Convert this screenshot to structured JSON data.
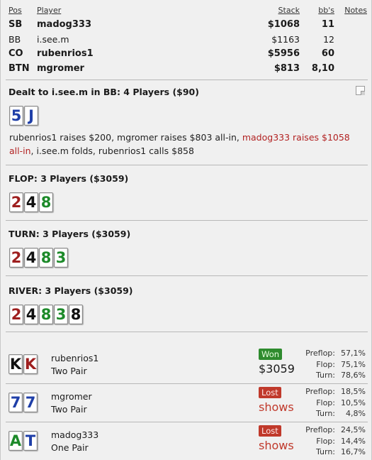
{
  "table": {
    "headers": {
      "pos": "Pos",
      "player": "Player",
      "stack": "Stack",
      "bb": "bb's",
      "notes": "Notes"
    },
    "rows": [
      {
        "pos": "SB",
        "player": "madog333",
        "stack": "$1068",
        "bb": "11",
        "bold": true
      },
      {
        "pos": "BB",
        "player": "i.see.m",
        "stack": "$1163",
        "bb": "12",
        "bold": false
      },
      {
        "pos": "CO",
        "player": "rubenrios1",
        "stack": "$5956",
        "bb": "60",
        "bold": true
      },
      {
        "pos": "BTN",
        "player": "mgromer",
        "stack": "$813",
        "bb": "8,10",
        "bold": true
      }
    ]
  },
  "preflop": {
    "title": "Dealt to i.see.m in BB: 4 Players ($90)",
    "cards": [
      {
        "rank": "5",
        "suit": "blue"
      },
      {
        "rank": "J",
        "suit": "blue"
      }
    ],
    "actions_plain_1": "rubenrios1 raises $200, mgromer raises $803 all-in, ",
    "actions_red": "madog333 raises $1058 all-in",
    "actions_plain_2": ", i.see.m folds, rubenrios1 calls $858"
  },
  "flop": {
    "title": "FLOP: 3 Players ($3059)",
    "cards": [
      {
        "rank": "2",
        "suit": "red"
      },
      {
        "rank": "4",
        "suit": "black"
      },
      {
        "rank": "8",
        "suit": "green"
      }
    ]
  },
  "turn": {
    "title": "TURN: 3 Players ($3059)",
    "cards": [
      {
        "rank": "2",
        "suit": "red"
      },
      {
        "rank": "4",
        "suit": "black"
      },
      {
        "rank": "8",
        "suit": "green"
      },
      {
        "rank": "3",
        "suit": "green"
      }
    ]
  },
  "river": {
    "title": "RIVER: 3 Players ($3059)",
    "cards": [
      {
        "rank": "2",
        "suit": "red"
      },
      {
        "rank": "4",
        "suit": "black"
      },
      {
        "rank": "8",
        "suit": "green"
      },
      {
        "rank": "3",
        "suit": "green"
      },
      {
        "rank": "8",
        "suit": "black"
      }
    ]
  },
  "results": [
    {
      "player": "rubenrios1",
      "hand": "Two Pair",
      "cards": [
        {
          "rank": "K",
          "suit": "black"
        },
        {
          "rank": "K",
          "suit": "red"
        }
      ],
      "status": "Won",
      "outcome": "won",
      "amount": "$3059",
      "stats": [
        {
          "label": "Preflop:",
          "value": "57,1%"
        },
        {
          "label": "Flop:",
          "value": "75,1%"
        },
        {
          "label": "Turn:",
          "value": "78,6%"
        }
      ]
    },
    {
      "player": "mgromer",
      "hand": "Two Pair",
      "cards": [
        {
          "rank": "7",
          "suit": "blue"
        },
        {
          "rank": "7",
          "suit": "blue"
        }
      ],
      "status": "Lost",
      "outcome": "lost",
      "amount": "shows",
      "stats": [
        {
          "label": "Preflop:",
          "value": "18,5%"
        },
        {
          "label": "Flop:",
          "value": "10,5%"
        },
        {
          "label": "Turn:",
          "value": "4,8%"
        }
      ]
    },
    {
      "player": "madog333",
      "hand": "One Pair",
      "cards": [
        {
          "rank": "A",
          "suit": "green"
        },
        {
          "rank": "T",
          "suit": "blue"
        }
      ],
      "status": "Lost",
      "outcome": "lost",
      "amount": "shows",
      "stats": [
        {
          "label": "Preflop:",
          "value": "24,5%"
        },
        {
          "label": "Flop:",
          "value": "14,4%"
        },
        {
          "label": "Turn:",
          "value": "16,7%"
        }
      ]
    }
  ],
  "colors": {
    "blue": "#1f3fa8",
    "red": "#9e1f1f",
    "green": "#1d8a2a",
    "black": "#111111",
    "won_badge": "#2e8b2e",
    "lost_badge": "#c0392b"
  },
  "icons": {
    "notes": "note-icon"
  }
}
